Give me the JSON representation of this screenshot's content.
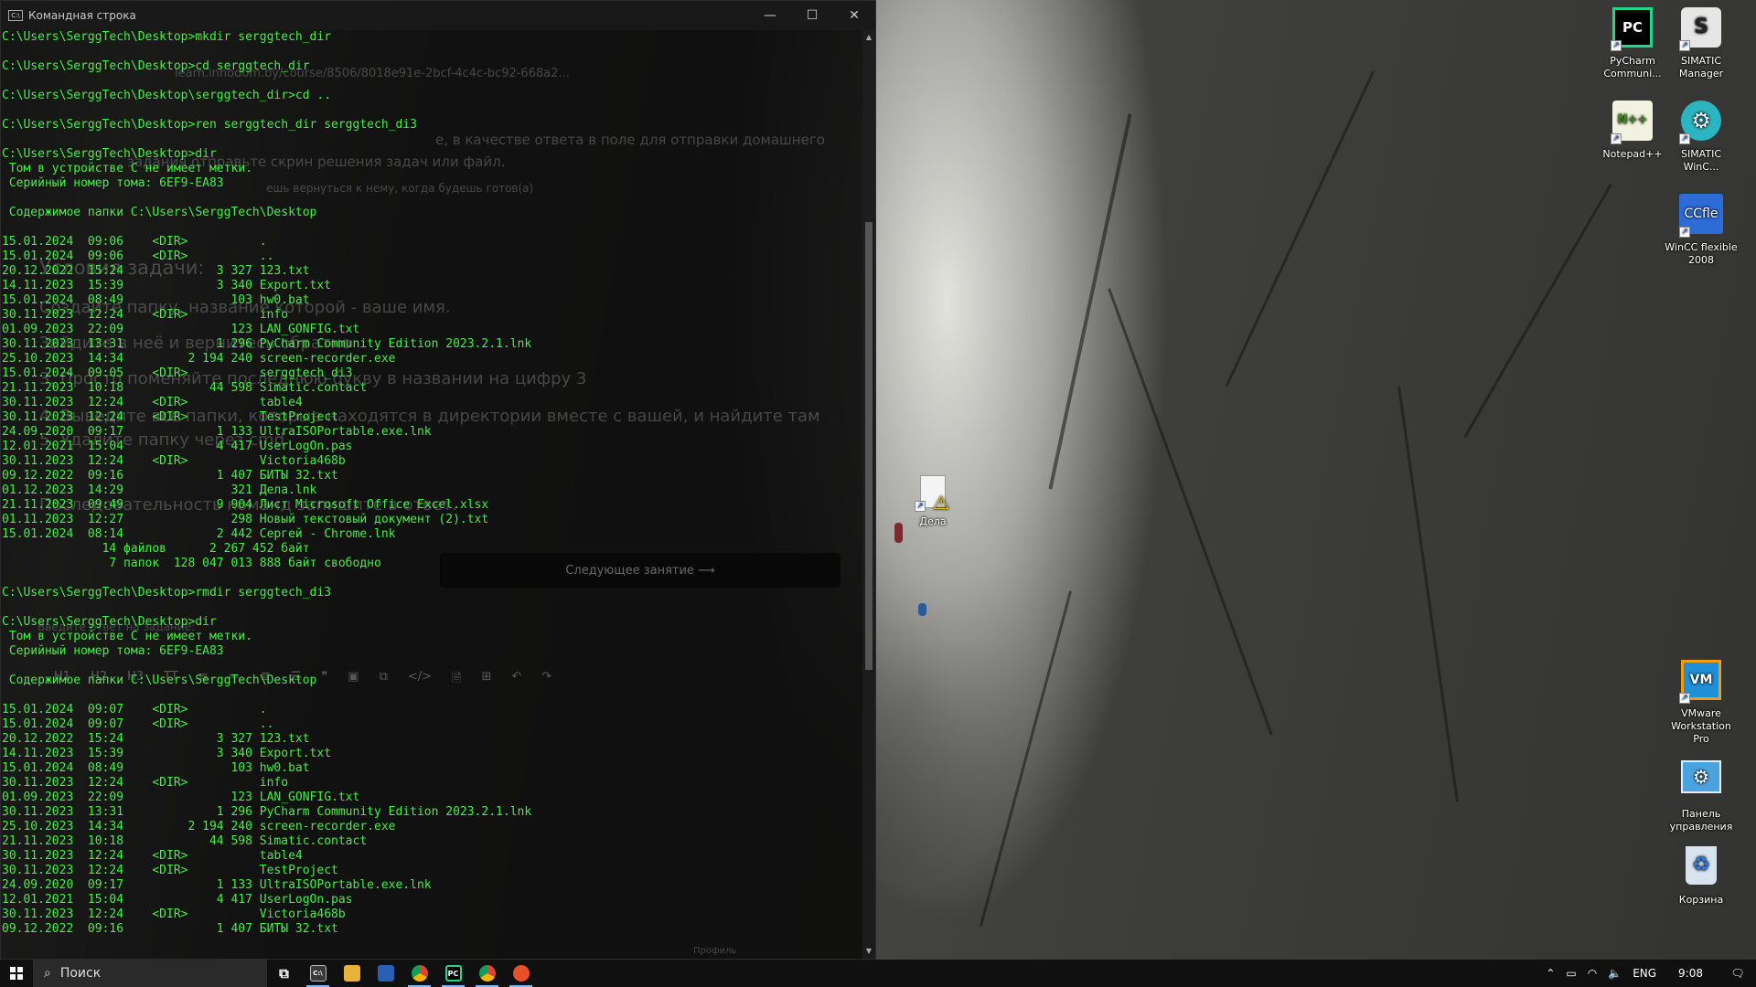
{
  "console": {
    "title": "Командная строка",
    "lines": [
      "C:\\Users\\SerggTech\\Desktop>mkdir serggtech_dir",
      "",
      "C:\\Users\\SerggTech\\Desktop>cd serggtech_dir",
      "",
      "C:\\Users\\SerggTech\\Desktop\\serggtech_dir>cd ..",
      "",
      "C:\\Users\\SerggTech\\Desktop>ren serggtech_dir serggtech_di3",
      "",
      "C:\\Users\\SerggTech\\Desktop>dir",
      " Том в устройстве C не имеет метки.",
      " Серийный номер тома: 6EF9-EA83",
      "",
      " Содержимое папки C:\\Users\\SerggTech\\Desktop",
      "",
      "15.01.2024  09:06    <DIR>          .",
      "15.01.2024  09:06    <DIR>          ..",
      "20.12.2022  15:24             3 327 123.txt",
      "14.11.2023  15:39             3 340 Export.txt",
      "15.01.2024  08:49               103 hw0.bat",
      "30.11.2023  12:24    <DIR>          info",
      "01.09.2023  22:09               123 LAN_GONFIG.txt",
      "30.11.2023  13:31             1 296 PyCharm Community Edition 2023.2.1.lnk",
      "25.10.2023  14:34         2 194 240 screen-recorder.exe",
      "15.01.2024  09:05    <DIR>          serggtech_di3",
      "21.11.2023  10:18            44 598 Simatic.contact",
      "30.11.2023  12:24    <DIR>          table4",
      "30.11.2023  12:24    <DIR>          TestProject",
      "24.09.2020  09:17             1 133 UltraISOPortable.exe.lnk",
      "12.01.2021  15:04             4 417 UserLogOn.pas",
      "30.11.2023  12:24    <DIR>          Victoria468b",
      "09.12.2022  09:16             1 407 БИТЫ 32.txt",
      "01.12.2023  14:29               321 Дела.lnk",
      "21.11.2023  09:49             9 904 Лист Microsoft Office Excel.xlsx",
      "01.11.2023  12:27               298 Новый текстовый документ (2).txt",
      "15.01.2024  08:14             2 442 Сергей - Chrome.lnk",
      "              14 файлов      2 267 452 байт",
      "               7 папок  128 047 013 888 байт свободно",
      "",
      "C:\\Users\\SerggTech\\Desktop>rmdir serggtech_di3",
      "",
      "C:\\Users\\SerggTech\\Desktop>dir",
      " Том в устройстве C не имеет метки.",
      " Серийный номер тома: 6EF9-EA83",
      "",
      " Содержимое папки C:\\Users\\SerggTech\\Desktop",
      "",
      "15.01.2024  09:07    <DIR>          .",
      "15.01.2024  09:07    <DIR>          ..",
      "20.12.2022  15:24             3 327 123.txt",
      "14.11.2023  15:39             3 340 Export.txt",
      "15.01.2024  08:49               103 hw0.bat",
      "30.11.2023  12:24    <DIR>          info",
      "01.09.2023  22:09               123 LAN_GONFIG.txt",
      "30.11.2023  13:31             1 296 PyCharm Community Edition 2023.2.1.lnk",
      "25.10.2023  14:34         2 194 240 screen-recorder.exe",
      "21.11.2023  10:18            44 598 Simatic.contact",
      "30.11.2023  12:24    <DIR>          table4",
      "30.11.2023  12:24    <DIR>          TestProject",
      "24.09.2020  09:17             1 133 UltraISOPortable.exe.lnk",
      "12.01.2021  15:04             4 417 UserLogOn.pas",
      "30.11.2023  12:24    <DIR>          Victoria468b",
      "09.12.2022  09:16             1 407 БИТЫ 32.txt"
    ]
  },
  "ghost_browser": {
    "url": "learn.innodom.by/course/8506/8018e91e-2bcf-4c4c-bc92-668a2...",
    "instruction_1": "е, в качестве ответа в поле для отправки домашнего",
    "instruction_2": "задания отправьте скрин решения задач или файл.",
    "instruction_3": "ешь вернуться к нему, когда будешь готов(а)",
    "conditions_title": "Условия задачи:",
    "task_1": "Создайте папку, название которой - ваше имя.",
    "task_2": "Зайдите в неё и вернитесь обратно",
    "task_3": "3. Просто поменяйте последнюю букву в названии на цифру 3",
    "task_4": "4. Выведите все папки, которые находятся в директории вместе с вашей, и найдите там",
    "task_4b": "5. Удалите папку через cmd",
    "task_5": "Последовательность команд запишите в ответ.",
    "next_lesson": "Следующее занятие  ⟶",
    "answer_label": "Введите ответ на задание:",
    "editor_tools": [
      "H1",
      "H2",
      "H3",
      "TT",
      "≡",
      "≔",
      "≣",
      "☰",
      "❞",
      "▣",
      "⧉",
      "</>",
      "🗎",
      "⊞",
      "↶",
      "↷"
    ],
    "profile_label": "Профиль"
  },
  "desktop": {
    "icons": [
      {
        "label": "PyCharm Communi...",
        "badge": "PC",
        "color": "#21d789"
      },
      {
        "label": "SIMATIC Manager",
        "badge": "S",
        "color": "#dddddd"
      },
      {
        "label": "Notepad++",
        "badge": "N++",
        "color": "#9ad15a"
      },
      {
        "label": "SIMATIC WinC...",
        "badge": "⚙",
        "color": "#2bb5c0"
      },
      {
        "label": "WinCC flexible 2008",
        "badge": "CCfle",
        "color": "#2d6bd6"
      },
      {
        "label": "VMware Workstation Pro",
        "badge": "VM",
        "color": "#1f8fd8"
      },
      {
        "label": "Панель управления",
        "badge": "⚙",
        "color": "#4aa3df"
      },
      {
        "label": "Корзина",
        "badge": "♻",
        "color": "#bfd4e6"
      },
      {
        "label": "Дела",
        "badge": "⚠",
        "color": "#f1c40f"
      }
    ]
  },
  "taskbar": {
    "search_placeholder": "Поиск",
    "apps": [
      {
        "name": "task-view",
        "glyph": "⧉",
        "color": "#101010"
      },
      {
        "name": "cmd",
        "glyph": "C:\\",
        "color": "#3a3a3a"
      },
      {
        "name": "explorer",
        "glyph": "📁",
        "color": "#e8b33a"
      },
      {
        "name": "save",
        "glyph": "💾",
        "color": "#2b5fb4"
      },
      {
        "name": "chrome",
        "glyph": "◉",
        "color": "#db4437"
      },
      {
        "name": "pycharm",
        "glyph": "PC",
        "color": "#000000"
      },
      {
        "name": "chrome-profile",
        "glyph": "◉",
        "color": "#db4437"
      },
      {
        "name": "screen-recorder",
        "glyph": "⬤",
        "color": "#e8502a"
      }
    ],
    "language": "ENG",
    "time": "9:08"
  }
}
